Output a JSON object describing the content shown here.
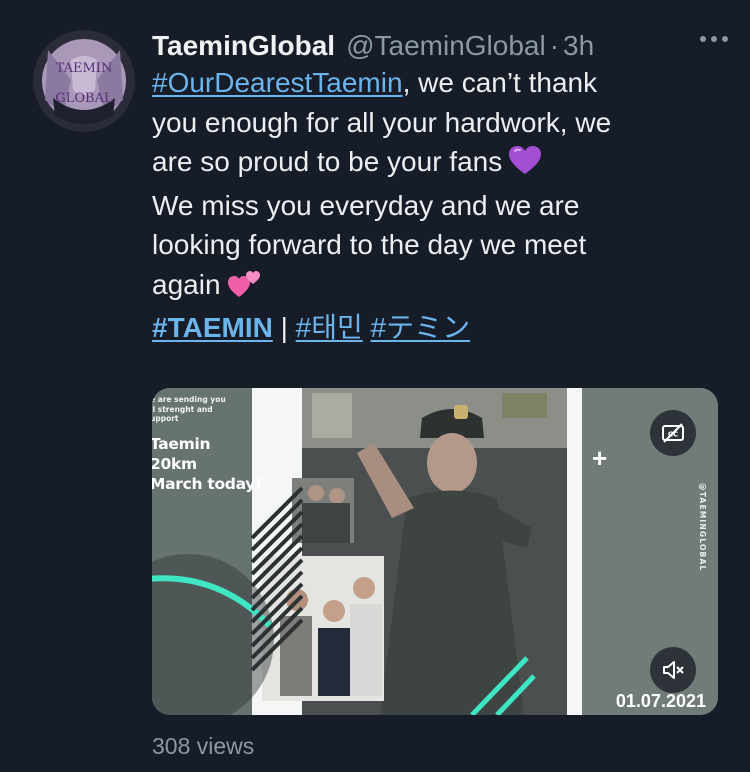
{
  "tweet": {
    "display_name": "TaeminGlobal",
    "handle": "@TaeminGlobal",
    "separator": "·",
    "timestamp": "3h",
    "more_icon": "more-horizontal-icon",
    "avatar_text": [
      "TAEMIN",
      "GLOBAL"
    ],
    "text": {
      "hashtag_1": "#OurDearestTaemin",
      "line_1_rest": ", we can’t thank",
      "line_2": "you enough for all your hardwork, we",
      "line_3": "are so proud to be your fans",
      "emoji_1": "purple-heart-emoji",
      "line_4": "We miss you everyday and we are",
      "line_5": "looking forward to the day we meet",
      "line_6": "again",
      "emoji_2": "two-hearts-emoji",
      "hashtag_2": "#TAEMIN",
      "pipe": "|",
      "hashtag_3": "#태민",
      "hashtag_4": "#テミン"
    },
    "media": {
      "overlay_small": [
        "e are sending you",
        "ll strenght and",
        "upport"
      ],
      "overlay_big": [
        "Taemin",
        "20km",
        "March today!"
      ],
      "plus": "+",
      "watermark": "@TAEMINGLOBAL",
      "date": "01.07.2021",
      "cc_icon": "captions-off-icon",
      "mute_icon": "volume-muted-icon",
      "accent_color": "#3fe6c4"
    },
    "views": "308 views"
  },
  "colors": {
    "background": "#161c28",
    "link": "#6cb4ec",
    "muted": "#8b98a5",
    "text": "#eceff1"
  }
}
